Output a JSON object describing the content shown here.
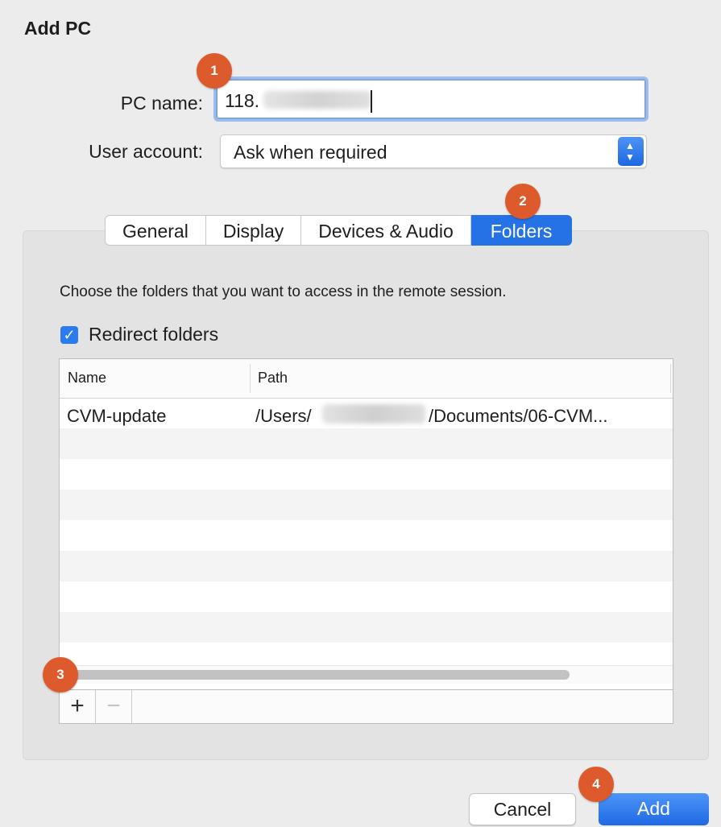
{
  "dialog": {
    "title": "Add PC"
  },
  "form": {
    "pc_name_label": "PC name:",
    "pc_name_value": "118.",
    "user_account_label": "User account:",
    "user_account_value": "Ask when required"
  },
  "tabs": [
    {
      "label": "General",
      "active": false
    },
    {
      "label": "Display",
      "active": false
    },
    {
      "label": "Devices & Audio",
      "active": false
    },
    {
      "label": "Folders",
      "active": true
    }
  ],
  "folders": {
    "instruction": "Choose the folders that you want to access in the remote session.",
    "redirect_label": "Redirect folders",
    "redirect_checked": true,
    "columns": {
      "name": "Name",
      "path": "Path"
    },
    "rows": [
      {
        "name": "CVM-update",
        "path_prefix": "/Users/",
        "path_suffix": "/Documents/06-CVM..."
      }
    ],
    "add_symbol": "+",
    "remove_symbol": "−"
  },
  "buttons": {
    "cancel": "Cancel",
    "add": "Add"
  },
  "callouts": [
    "1",
    "2",
    "3",
    "4"
  ],
  "colors": {
    "accent": "#2572e6",
    "callout": "#dd5a2c"
  }
}
